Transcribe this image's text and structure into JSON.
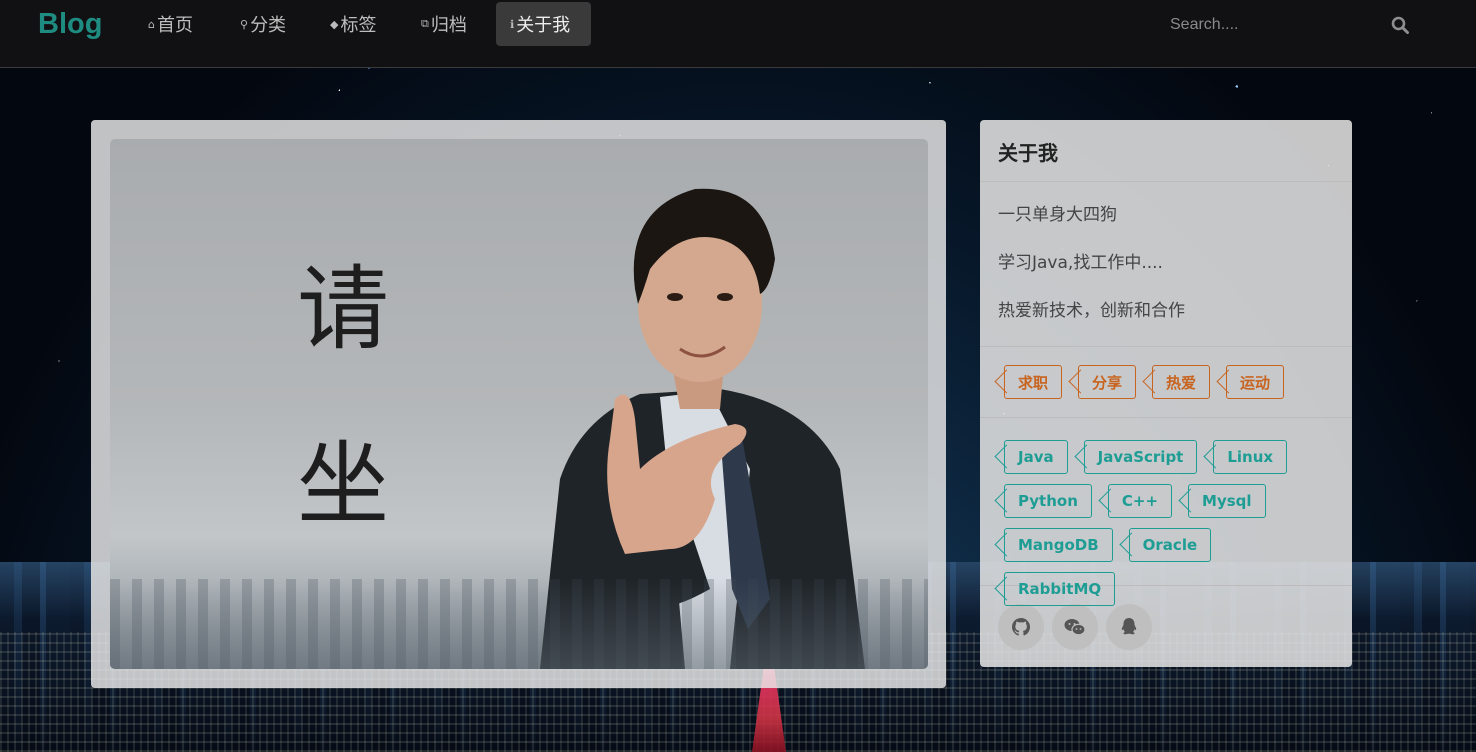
{
  "brand": "Blog",
  "nav": [
    {
      "label": "首页",
      "icon": "home-icon",
      "active": false
    },
    {
      "label": "分类",
      "icon": "map-marker-icon",
      "active": false
    },
    {
      "label": "标签",
      "icon": "tag-icon",
      "active": false
    },
    {
      "label": "归档",
      "icon": "clone-icon",
      "active": false
    },
    {
      "label": "关于我",
      "icon": "info-icon",
      "active": true
    }
  ],
  "search": {
    "placeholder": "Search...."
  },
  "photo": {
    "text_line1": "请",
    "text_line2": "坐"
  },
  "about": {
    "title": "关于我",
    "bio": [
      "一只单身大四狗",
      "学习Java,找工作中....",
      "热爱新技术，创新和合作"
    ],
    "interests": [
      "求职",
      "分享",
      "热爱",
      "运动"
    ],
    "skills": [
      "Java",
      "JavaScript",
      "Linux",
      "Python",
      "C++",
      "Mysql",
      "MangoDB",
      "Oracle",
      "RabbitMQ"
    ],
    "social": [
      "github-icon",
      "wechat-icon",
      "qq-icon"
    ]
  },
  "colors": {
    "brand": "#1e8c80",
    "interest_tag": "#c8641f",
    "skill_tag": "#1e9d95"
  }
}
